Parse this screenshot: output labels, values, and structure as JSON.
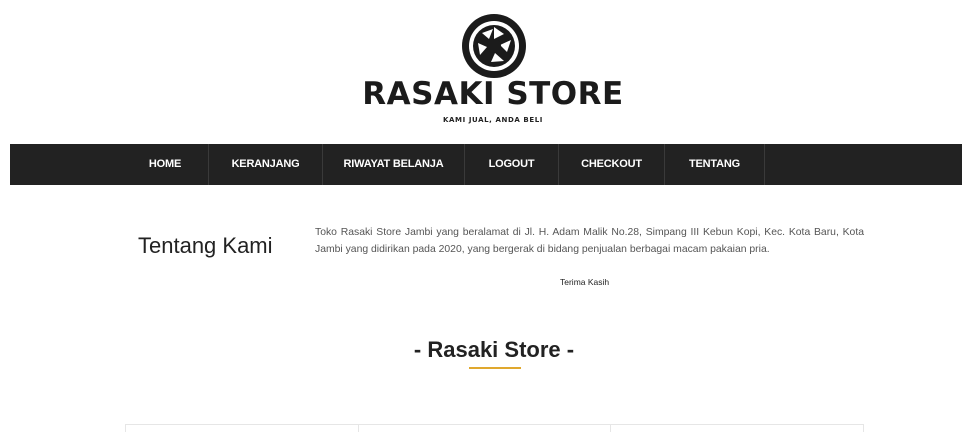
{
  "header": {
    "brand": "RASAKI STORE",
    "tagline": "KAMI JUAL, ANDA BELI",
    "logo_icon": "camera-aperture-icon"
  },
  "nav": {
    "items": [
      {
        "label": "HOME"
      },
      {
        "label": "KERANJANG"
      },
      {
        "label": "RIWAYAT BELANJA"
      },
      {
        "label": "LOGOUT"
      },
      {
        "label": "CHECKOUT"
      },
      {
        "label": "TENTANG"
      }
    ]
  },
  "about": {
    "title": "Tentang Kami",
    "text": "Toko Rasaki Store Jambi yang beralamat di Jl. H. Adam Malik No.28, Simpang III Kebun Kopi, Kec. Kota Baru, Kota Jambi yang didirikan pada 2020, yang bergerak di bidang penjualan berbagai macam pakaian pria.",
    "thanks": "Terima Kasih"
  },
  "section": {
    "heading": "- Rasaki Store -"
  },
  "colors": {
    "nav_bg": "#222222",
    "accent": "#e0a82e"
  }
}
